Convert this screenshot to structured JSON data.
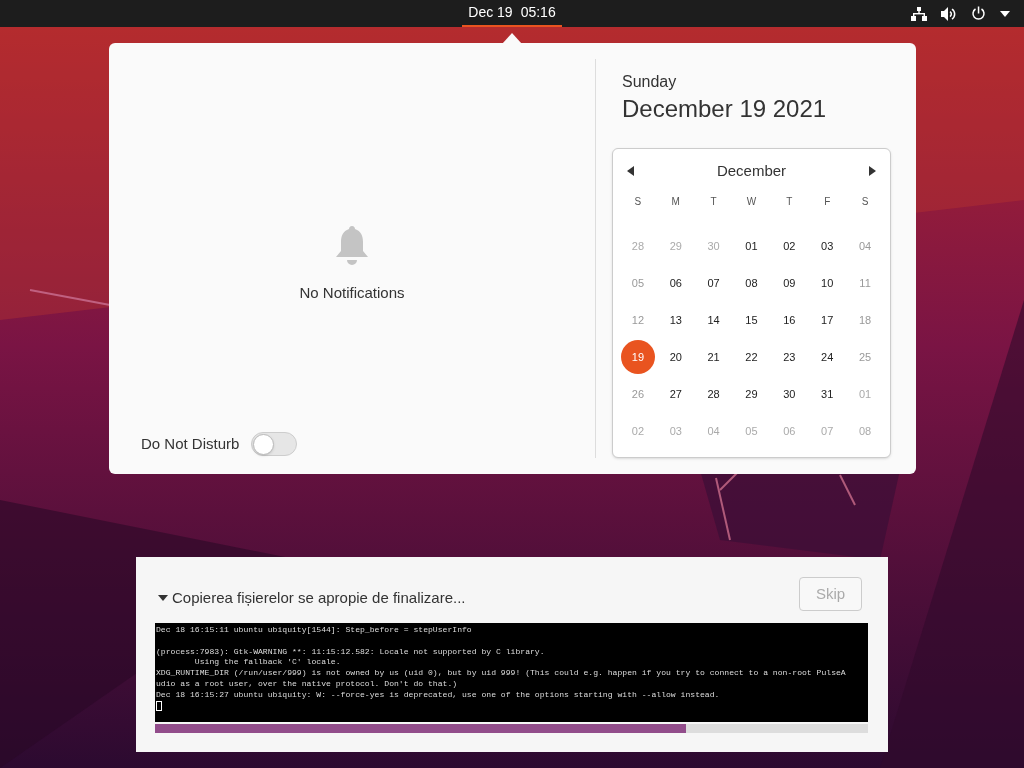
{
  "top_bar": {
    "clock_date": "Dec 19",
    "clock_time": "05:16",
    "clock_open": true
  },
  "notifications": {
    "empty_text": "No Notifications",
    "do_not_disturb": {
      "label": "Do Not Disturb",
      "on": false
    }
  },
  "date_header": {
    "weekday": "Sunday",
    "date": "December 19 2021"
  },
  "calendar": {
    "month": "December",
    "weekdays": [
      "S",
      "M",
      "T",
      "W",
      "T",
      "F",
      "S"
    ],
    "days": [
      {
        "label": "28",
        "kind": "other",
        "selected": false
      },
      {
        "label": "29",
        "kind": "other",
        "selected": false
      },
      {
        "label": "30",
        "kind": "other",
        "selected": false
      },
      {
        "label": "01",
        "kind": "current",
        "selected": false
      },
      {
        "label": "02",
        "kind": "current",
        "selected": false
      },
      {
        "label": "03",
        "kind": "current",
        "selected": false
      },
      {
        "label": "04",
        "kind": "weekend",
        "selected": false
      },
      {
        "label": "05",
        "kind": "weekend",
        "selected": false
      },
      {
        "label": "06",
        "kind": "current",
        "selected": false
      },
      {
        "label": "07",
        "kind": "current",
        "selected": false
      },
      {
        "label": "08",
        "kind": "current",
        "selected": false
      },
      {
        "label": "09",
        "kind": "current",
        "selected": false
      },
      {
        "label": "10",
        "kind": "current",
        "selected": false
      },
      {
        "label": "11",
        "kind": "weekend",
        "selected": false
      },
      {
        "label": "12",
        "kind": "weekend",
        "selected": false
      },
      {
        "label": "13",
        "kind": "current",
        "selected": false
      },
      {
        "label": "14",
        "kind": "current",
        "selected": false
      },
      {
        "label": "15",
        "kind": "current",
        "selected": false
      },
      {
        "label": "16",
        "kind": "current",
        "selected": false
      },
      {
        "label": "17",
        "kind": "current",
        "selected": false
      },
      {
        "label": "18",
        "kind": "weekend",
        "selected": false
      },
      {
        "label": "19",
        "kind": "weekend",
        "selected": true
      },
      {
        "label": "20",
        "kind": "current",
        "selected": false
      },
      {
        "label": "21",
        "kind": "current",
        "selected": false
      },
      {
        "label": "22",
        "kind": "current",
        "selected": false
      },
      {
        "label": "23",
        "kind": "current",
        "selected": false
      },
      {
        "label": "24",
        "kind": "current",
        "selected": false
      },
      {
        "label": "25",
        "kind": "weekend",
        "selected": false
      },
      {
        "label": "26",
        "kind": "weekend",
        "selected": false
      },
      {
        "label": "27",
        "kind": "current",
        "selected": false
      },
      {
        "label": "28",
        "kind": "current",
        "selected": false
      },
      {
        "label": "29",
        "kind": "current",
        "selected": false
      },
      {
        "label": "30",
        "kind": "current",
        "selected": false
      },
      {
        "label": "31",
        "kind": "current",
        "selected": false
      },
      {
        "label": "01",
        "kind": "other",
        "selected": false
      },
      {
        "label": "02",
        "kind": "other",
        "selected": false
      },
      {
        "label": "03",
        "kind": "other",
        "selected": false
      },
      {
        "label": "04",
        "kind": "other",
        "selected": false
      },
      {
        "label": "05",
        "kind": "other",
        "selected": false
      },
      {
        "label": "06",
        "kind": "other",
        "selected": false
      },
      {
        "label": "07",
        "kind": "other",
        "selected": false
      },
      {
        "label": "08",
        "kind": "other",
        "selected": false
      }
    ]
  },
  "installer": {
    "status": "Copierea fișierelor se apropie de finalizare...",
    "details_expanded": true,
    "skip_button": {
      "label": "Skip",
      "disabled": true
    },
    "terminal": {
      "cursor": true,
      "blocks": [
        [
          "Dec 18 16:15:11 ubuntu ubiquity[1544]: Step_before = stepUserInfo"
        ],
        [
          "(process:7983): Gtk-WARNING **: 11:15:12.582: Locale not supported by C library.",
          "        Using the fallback 'C' locale.",
          "XDG_RUNTIME_DIR (/run/user/999) is not owned by us (uid 0), but by uid 999! (This could e.g. happen if you try to connect to a non-root PulseA",
          "udio as a root user, over the native protocol. Don't do that.)",
          "Dec 18 16:15:27 ubuntu ubiquity: W: --force-yes is deprecated, use one of the options starting with --allow instead."
        ]
      ]
    },
    "progress": {
      "level": 0.745
    }
  }
}
